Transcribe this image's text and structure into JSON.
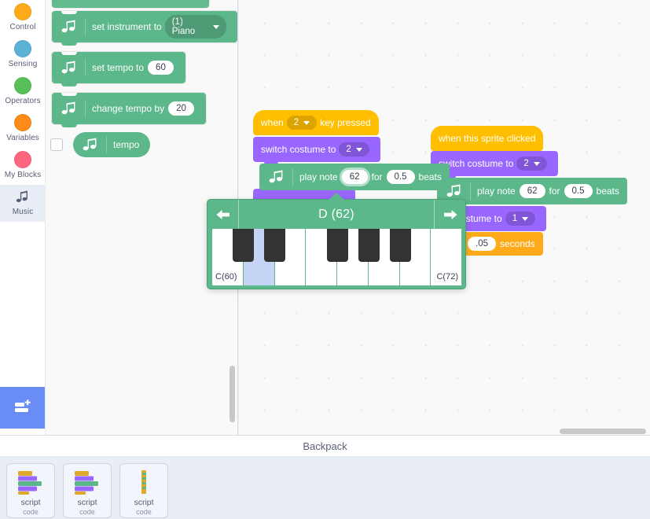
{
  "sidebar": {
    "categories": [
      {
        "label": "Control",
        "color": "#ffab19",
        "icon": "circle-icon"
      },
      {
        "label": "Sensing",
        "color": "#5cb1d6",
        "icon": "circle-icon"
      },
      {
        "label": "Operators",
        "color": "#59c059",
        "icon": "circle-icon"
      },
      {
        "label": "Variables",
        "color": "#ff8c1a",
        "icon": "circle-icon"
      },
      {
        "label": "My Blocks",
        "color": "#ff6680",
        "icon": "circle-icon"
      },
      {
        "label": "Music",
        "color": "#5cb88b",
        "icon": "music-note-icon",
        "selected": true
      }
    ],
    "add_extension_label": "Add Extension",
    "add_extension_icon": "add-extension-icon"
  },
  "palette": {
    "blocks": [
      {
        "id": "set-instrument",
        "label": "set instrument to",
        "icon": "music-note-icon",
        "field_type": "dropdown",
        "field_value": "(1) Piano"
      },
      {
        "id": "set-tempo",
        "label": "set tempo to",
        "icon": "music-note-icon",
        "field_type": "number",
        "field_value": "60"
      },
      {
        "id": "change-tempo",
        "label": "change tempo by",
        "icon": "music-note-icon",
        "field_type": "number",
        "field_value": "20"
      }
    ],
    "reporter": {
      "label": "tempo",
      "icon": "music-note-icon",
      "checkbox_checked": false
    }
  },
  "workspace": {
    "script_left": {
      "hat": {
        "prefix": "when",
        "key": "2",
        "suffix": "key pressed"
      },
      "costume": {
        "label": "switch costume to",
        "value": "2"
      },
      "play_note": {
        "label_a": "play note",
        "note": "62",
        "label_b": "for",
        "beats": "0.5",
        "label_c": "beats",
        "icon": "music-note-icon",
        "note_selected": true
      }
    },
    "script_right": {
      "hat": {
        "label": "when this sprite clicked"
      },
      "costume_1": {
        "label": "switch costume to",
        "value": "2"
      },
      "play_note": {
        "label_a": "play note",
        "note": "62",
        "label_b": "for",
        "beats": "0.5",
        "label_c": "beats",
        "icon": "music-note-icon"
      },
      "costume_2": {
        "label": "ostume to",
        "value": "1"
      },
      "wait": {
        "value": ".05",
        "label": "seconds"
      }
    }
  },
  "piano": {
    "title": "D (62)",
    "prev_icon": "arrow-left-icon",
    "next_icon": "arrow-right-icon",
    "low_label": "C(60)",
    "high_label": "C(72)",
    "active_key_index": 1,
    "white_keys": 8,
    "black_key_positions": [
      0,
      1,
      3,
      4,
      5
    ]
  },
  "backpack": {
    "title": "Backpack",
    "items": [
      {
        "name": "script",
        "type": "code",
        "thumb": "script-blocks-icon"
      },
      {
        "name": "script",
        "type": "code",
        "thumb": "script-blocks-icon"
      },
      {
        "name": "script",
        "type": "code",
        "thumb": "script-strip-icon"
      }
    ]
  }
}
